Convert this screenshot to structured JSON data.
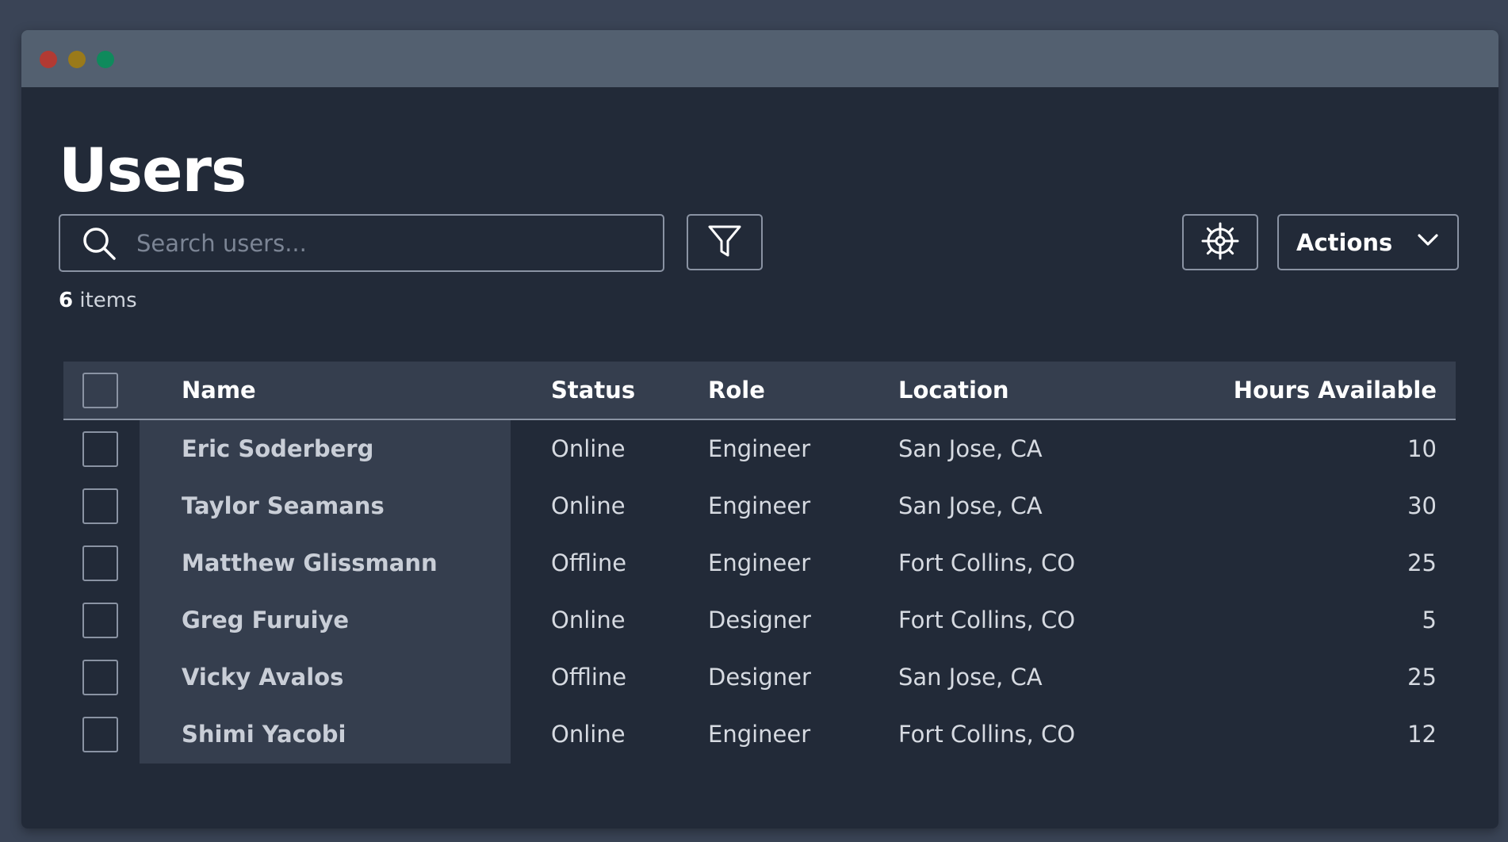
{
  "window": {
    "controls": [
      "close",
      "minimize",
      "maximize"
    ]
  },
  "page": {
    "title": "Users"
  },
  "search": {
    "placeholder": "Search users...",
    "value": ""
  },
  "toolbar": {
    "filter_icon": "filter-icon",
    "settings_icon": "gear-icon",
    "actions_label": "Actions",
    "actions_icon": "chevron-down-icon"
  },
  "summary": {
    "count": "6",
    "label": " items"
  },
  "table": {
    "columns": {
      "name": "Name",
      "status": "Status",
      "role": "Role",
      "location": "Location",
      "hours": "Hours Available"
    },
    "rows": [
      {
        "name": "Eric Soderberg",
        "status": "Online",
        "role": "Engineer",
        "location": "San Jose, CA",
        "hours": "10"
      },
      {
        "name": "Taylor Seamans",
        "status": "Online",
        "role": "Engineer",
        "location": "San Jose, CA",
        "hours": "30"
      },
      {
        "name": "Matthew Glissmann",
        "status": "Offline",
        "role": "Engineer",
        "location": "Fort Collins, CO",
        "hours": "25"
      },
      {
        "name": "Greg Furuiye",
        "status": "Online",
        "role": "Designer",
        "location": "Fort Collins, CO",
        "hours": "5"
      },
      {
        "name": "Vicky Avalos",
        "status": "Offline",
        "role": "Designer",
        "location": "San Jose, CA",
        "hours": "25"
      },
      {
        "name": "Shimi Yacobi",
        "status": "Online",
        "role": "Engineer",
        "location": "Fort Collins, CO",
        "hours": "12"
      }
    ]
  },
  "colors": {
    "background": "#3a4456",
    "window": "#222a38",
    "titlebar": "#536070",
    "header_row": "#353e4e",
    "border": "#8a93a3"
  }
}
